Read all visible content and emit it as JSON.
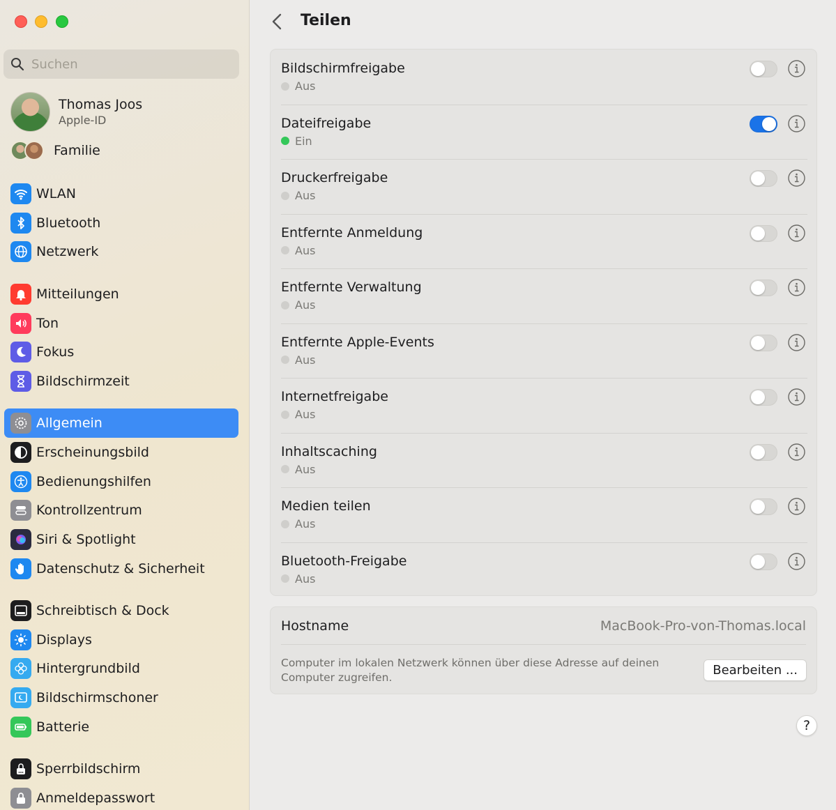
{
  "window": {
    "title": "Teilen"
  },
  "sidebar": {
    "search_placeholder": "Suchen",
    "account": {
      "name": "Thomas Joos",
      "subtitle": "Apple-ID"
    },
    "family_label": "Familie",
    "items": [
      {
        "label": "WLAN",
        "icon": "wifi-icon",
        "color": "#1e88f0"
      },
      {
        "label": "Bluetooth",
        "icon": "bluetooth-icon",
        "color": "#1e88f0"
      },
      {
        "label": "Netzwerk",
        "icon": "globe-icon",
        "color": "#1e88f0"
      },
      {
        "label": "Mitteilungen",
        "icon": "bell-icon",
        "color": "#ff3b30"
      },
      {
        "label": "Ton",
        "icon": "speaker-icon",
        "color": "#ff3b5c"
      },
      {
        "label": "Fokus",
        "icon": "moon-icon",
        "color": "#5e5ce6"
      },
      {
        "label": "Bildschirmzeit",
        "icon": "hourglass-icon",
        "color": "#5e5ce6"
      },
      {
        "label": "Allgemein",
        "icon": "gear-icon",
        "color": "#8e8e93",
        "selected": true
      },
      {
        "label": "Erscheinungsbild",
        "icon": "appearance-icon",
        "color": "#1d1d1f"
      },
      {
        "label": "Bedienungshilfen",
        "icon": "accessibility-icon",
        "color": "#1e88f0"
      },
      {
        "label": "Kontrollzentrum",
        "icon": "switches-icon",
        "color": "#8e8e93"
      },
      {
        "label": "Siri & Spotlight",
        "icon": "siri-icon",
        "color": "#2b2b3f"
      },
      {
        "label": "Datenschutz & Sicherheit",
        "icon": "hand-icon",
        "color": "#1e88f0"
      },
      {
        "label": "Schreibtisch & Dock",
        "icon": "dock-icon",
        "color": "#1d1d1f"
      },
      {
        "label": "Displays",
        "icon": "sun-icon",
        "color": "#1e88f0"
      },
      {
        "label": "Hintergrundbild",
        "icon": "flower-icon",
        "color": "#35aaf0"
      },
      {
        "label": "Bildschirmschoner",
        "icon": "screensaver-icon",
        "color": "#35aaf0"
      },
      {
        "label": "Batterie",
        "icon": "battery-icon",
        "color": "#34c759"
      },
      {
        "label": "Sperrbildschirm",
        "icon": "lockscreen-icon",
        "color": "#1d1d1f"
      },
      {
        "label": "Anmeldepasswort",
        "icon": "lock-icon",
        "color": "#8e8e93"
      }
    ]
  },
  "sharing": {
    "services": [
      {
        "name": "Bildschirmfreigabe",
        "status": "Aus",
        "on": false
      },
      {
        "name": "Dateifreigabe",
        "status": "Ein",
        "on": true
      },
      {
        "name": "Druckerfreigabe",
        "status": "Aus",
        "on": false
      },
      {
        "name": "Entfernte Anmeldung",
        "status": "Aus",
        "on": false
      },
      {
        "name": "Entfernte Verwaltung",
        "status": "Aus",
        "on": false
      },
      {
        "name": "Entfernte Apple-Events",
        "status": "Aus",
        "on": false
      },
      {
        "name": "Internetfreigabe",
        "status": "Aus",
        "on": false
      },
      {
        "name": "Inhaltscaching",
        "status": "Aus",
        "on": false
      },
      {
        "name": "Medien teilen",
        "status": "Aus",
        "on": false
      },
      {
        "name": "Bluetooth-Freigabe",
        "status": "Aus",
        "on": false
      }
    ],
    "host": {
      "label": "Hostname",
      "value": "MacBook-Pro-von-Thomas.local",
      "description": "Computer im lokalen Netzwerk können über diese Adresse auf deinen Computer zugreifen.",
      "edit_label": "Bearbeiten ..."
    },
    "help_label": "?",
    "accent": "#1a73e8"
  }
}
